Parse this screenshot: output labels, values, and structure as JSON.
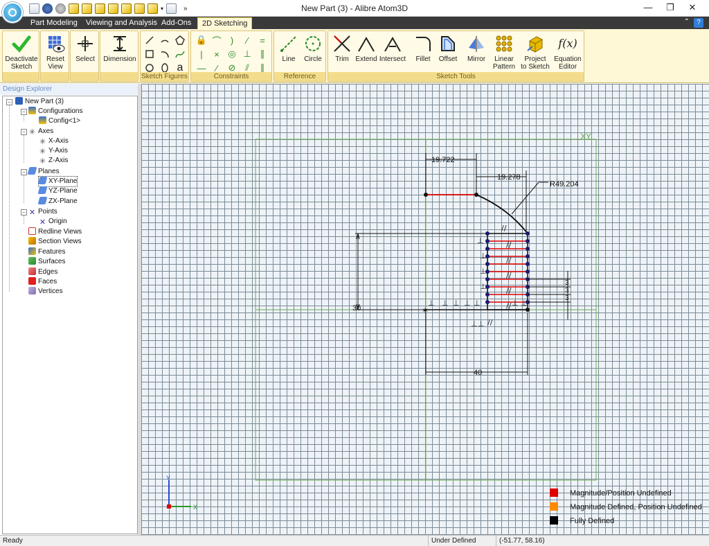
{
  "window": {
    "title": "New Part (3) - Alibre Atom3D"
  },
  "tabs": [
    {
      "label": "Part Modeling"
    },
    {
      "label": "Viewing and Analysis"
    },
    {
      "label": "Add-Ons"
    },
    {
      "label": "2D Sketching"
    }
  ],
  "ribbon": {
    "buttons": {
      "deactivate": "Deactivate\nSketch",
      "reset_view": "Reset\nView",
      "select": "Select",
      "dimension": "Dimension",
      "line": "Line",
      "circle": "Circle",
      "trim": "Trim",
      "extend": "Extend",
      "intersect": "Intersect",
      "fillet": "Fillet",
      "offset": "Offset",
      "mirror": "Mirror",
      "linear_pattern": "Linear\nPattern",
      "project": "Project\nto Sketch",
      "equation": "Equation\nEditor"
    },
    "groups": {
      "sketch_figures": "Sketch Figures",
      "constraints": "Constraints",
      "reference": "Reference",
      "sketch_tools": "Sketch Tools"
    }
  },
  "explorer": {
    "title": "Design Explorer",
    "items": [
      {
        "label": "New Part (3)"
      },
      {
        "label": "Configurations"
      },
      {
        "label": "Config<1>"
      },
      {
        "label": "Axes"
      },
      {
        "label": "X-Axis"
      },
      {
        "label": "Y-Axis"
      },
      {
        "label": "Z-Axis"
      },
      {
        "label": "Planes"
      },
      {
        "label": "XY-Plane"
      },
      {
        "label": "YZ-Plane"
      },
      {
        "label": "ZX-Plane"
      },
      {
        "label": "Points"
      },
      {
        "label": "Origin"
      },
      {
        "label": "Redline Views"
      },
      {
        "label": "Section Views"
      },
      {
        "label": "Features"
      },
      {
        "label": "Surfaces"
      },
      {
        "label": "Edges"
      },
      {
        "label": "Faces"
      },
      {
        "label": "Vertices"
      }
    ]
  },
  "canvas": {
    "plane_label": "XY",
    "dimensions": {
      "d1": "19.722",
      "d2": "19.278",
      "radius": "R49.204",
      "height": "30",
      "width": "40",
      "small": "3"
    }
  },
  "legend": [
    {
      "label": "Magnitude/Position Undefined",
      "color": "#e00000"
    },
    {
      "label": "Magnitude Defined, Position Undefined",
      "color": "#ff8a00"
    },
    {
      "label": "Fully Defined",
      "color": "#000000"
    }
  ],
  "status": {
    "ready": "Ready",
    "state": "Under Defined",
    "coords": "(-51.77, 58.16)"
  }
}
